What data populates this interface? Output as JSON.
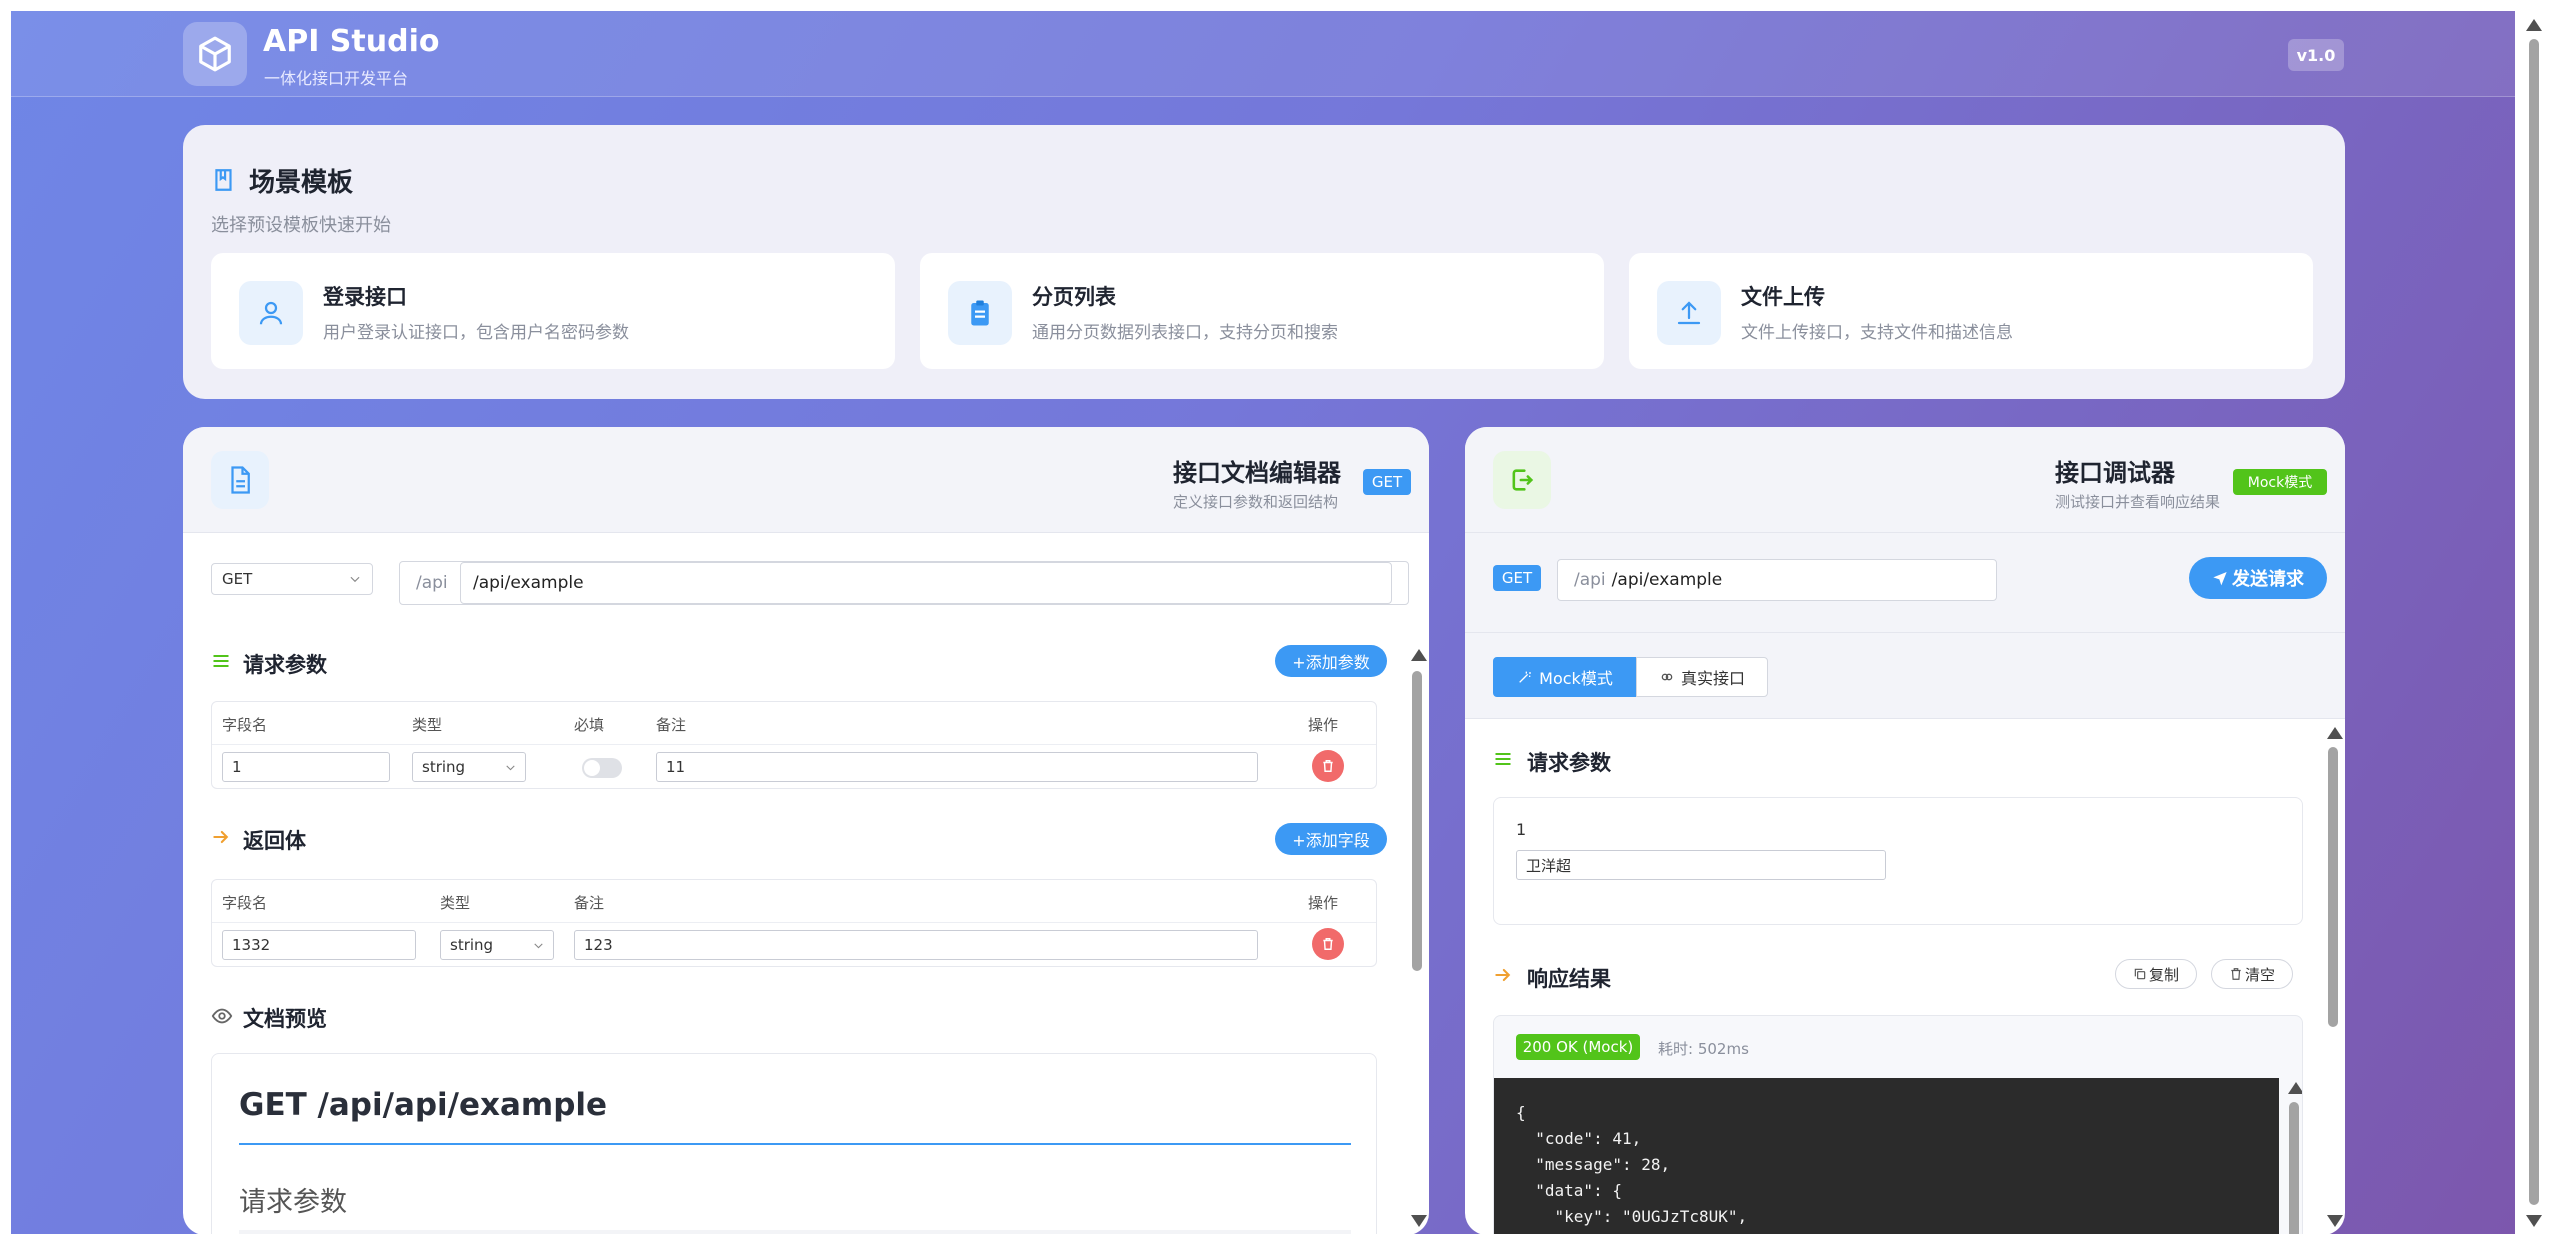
{
  "header": {
    "title": "API Studio",
    "subtitle": "一体化接口开发平台",
    "version": "v1.0"
  },
  "templates": {
    "title": "场景模板",
    "subtitle": "选择预设模板快速开始",
    "items": [
      {
        "name": "登录接口",
        "desc": "用户登录认证接口，包含用户名密码参数",
        "icon": "user-icon"
      },
      {
        "name": "分页列表",
        "desc": "通用分页数据列表接口，支持分页和搜索",
        "icon": "clipboard-icon"
      },
      {
        "name": "文件上传",
        "desc": "文件上传接口，支持文件和描述信息",
        "icon": "upload-icon"
      }
    ]
  },
  "editor": {
    "title": "接口文档编辑器",
    "subtitle": "定义接口参数和返回结构",
    "method_badge": "GET",
    "method_select": "GET",
    "path_prefix": "/api",
    "path_value": "/api/example",
    "params": {
      "title": "请求参数",
      "add_label": "+添加参数",
      "headers": [
        "字段名",
        "类型",
        "必填",
        "备注",
        "操作"
      ],
      "rows": [
        {
          "field": "1",
          "type": "string",
          "note": "11"
        }
      ]
    },
    "response": {
      "title": "返回体",
      "add_label": "+添加字段",
      "headers": [
        "字段名",
        "类型",
        "备注",
        "操作"
      ],
      "rows": [
        {
          "field": "1332",
          "type": "string",
          "note": "123"
        }
      ]
    },
    "preview": {
      "title": "文档预览",
      "heading": "GET /api/api/example",
      "subheading": "请求参数"
    }
  },
  "debugger": {
    "title": "接口调试器",
    "subtitle": "测试接口并查看响应结果",
    "mode_badge": "Mock模式",
    "method": "GET",
    "url_prefix": "/api",
    "url_value": "/api/example",
    "send_label": "发送请求",
    "modes": [
      "Mock模式",
      "真实接口"
    ],
    "params_title": "请求参数",
    "param_label": "1",
    "param_value": "卫洋超",
    "response_title": "响应结果",
    "copy_label": "复制",
    "clear_label": "清空",
    "status": "200 OK (Mock)",
    "elapsed": "耗时: 502ms",
    "code": "{\n  \"code\": 41,\n  \"message\": 28,\n  \"data\": {\n    \"key\": \"0UGJzTc8UK\","
  },
  "colors": {
    "accent": "#3c99f4",
    "green": "#52c41a",
    "danger": "#f16a6a",
    "orange": "#f0a030"
  }
}
